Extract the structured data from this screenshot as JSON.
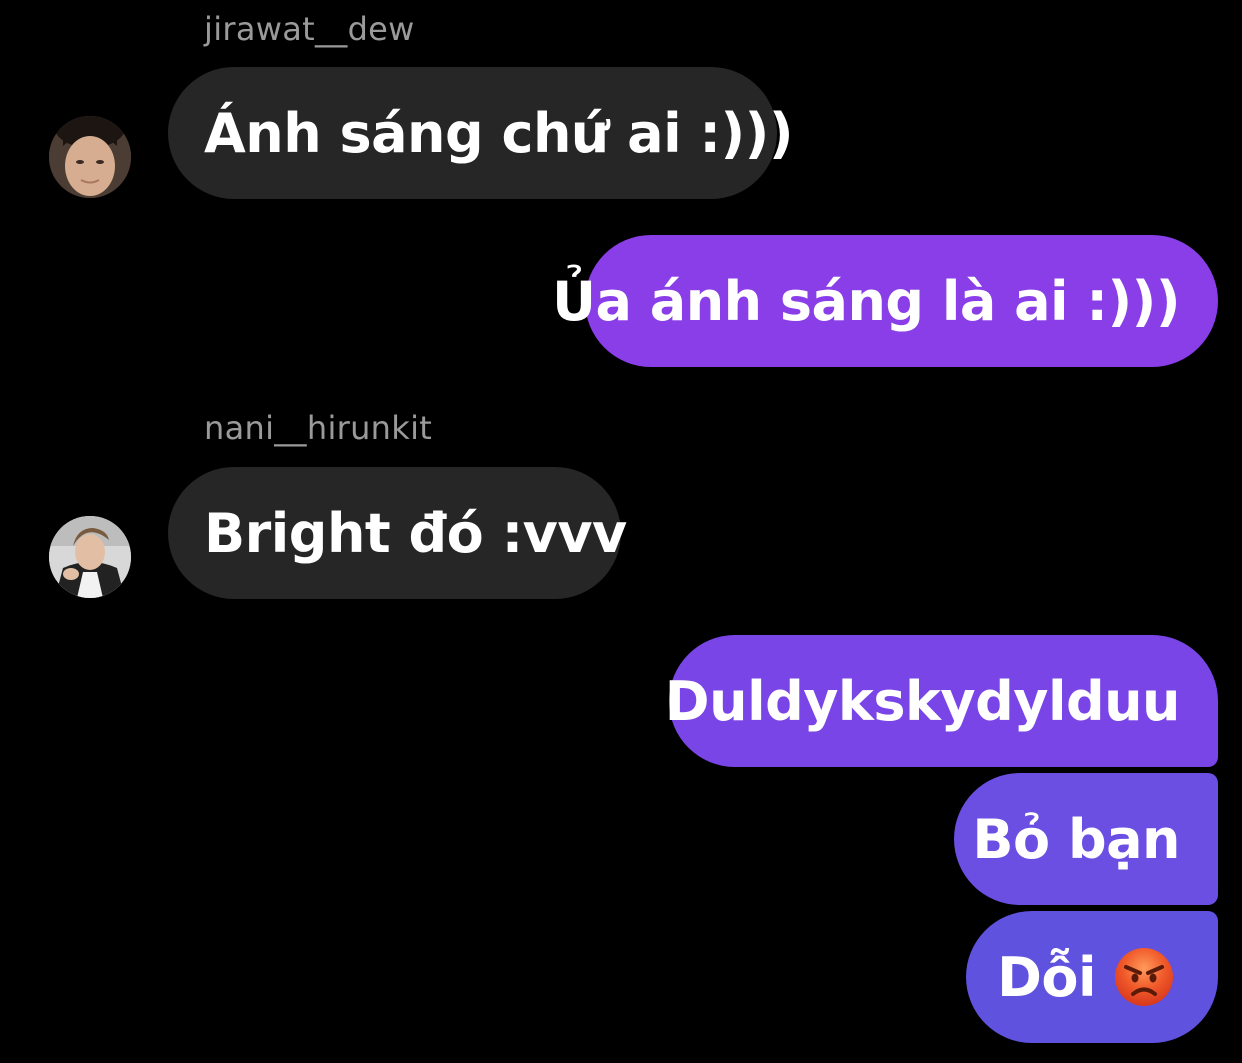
{
  "conversation": {
    "colors": {
      "background": "#000000",
      "incoming_bubble": "#262626",
      "sender_name": "#9a9a9a",
      "outgoing_gradient": [
        "#8a3ee8",
        "#7a45e6",
        "#6b4ee2",
        "#5f52df"
      ]
    },
    "messages": [
      {
        "type": "incoming",
        "sender": "jirawat__dew",
        "text": "Ánh sáng chứ ai :)))"
      },
      {
        "type": "outgoing",
        "text": "Ủa ánh sáng là ai :)))"
      },
      {
        "type": "incoming",
        "sender": "nani__hirunkit",
        "text": "Bright đó :vvv"
      },
      {
        "type": "outgoing",
        "text": "Duldykskydylduu"
      },
      {
        "type": "outgoing",
        "text": "Bỏ bạn"
      },
      {
        "type": "outgoing",
        "text": "Dỗi",
        "emoji": "angry-face-icon"
      }
    ]
  }
}
